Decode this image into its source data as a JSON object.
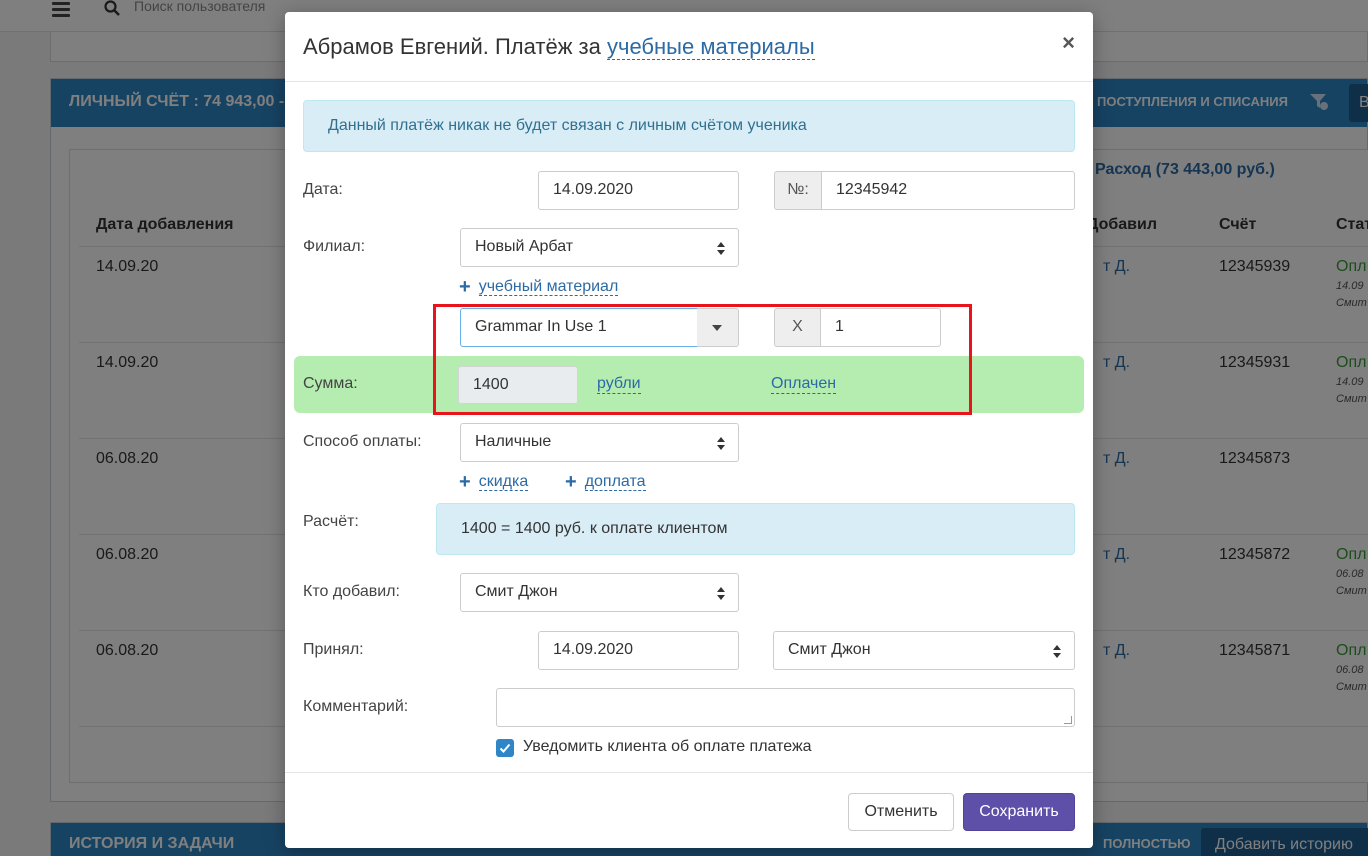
{
  "background": {
    "search_placeholder": "Поиск пользователя",
    "account_title": "ЛИЧНЫЙ СЧЁТ :  74 943,00 -",
    "account_right": "ПОСТУПЛЕНИЯ И СПИСАНИЯ",
    "header_btn": "В",
    "expense_link": "Расход (73 443,00 руб.)",
    "columns": [
      "Дата добавления",
      "Добавил",
      "Счёт",
      "Стат"
    ],
    "rows": [
      {
        "date": "14.09.20",
        "added_by": "т Д.",
        "account": "12345939",
        "status": "Опл",
        "status_date": "14.09",
        "status_user": "Смит"
      },
      {
        "date": "14.09.20",
        "added_by": "т Д.",
        "account": "12345931",
        "status": "Опл",
        "status_date": "14.09",
        "status_user": "Смит"
      },
      {
        "date": "06.08.20",
        "added_by": "т Д.",
        "account": "12345873",
        "status": "",
        "status_date": "",
        "status_user": ""
      },
      {
        "date": "06.08.20",
        "added_by": "т Д.",
        "account": "12345872",
        "status": "Опл",
        "status_date": "06.08",
        "status_user": "Смит"
      },
      {
        "date": "06.08.20",
        "added_by": "т Д.",
        "account": "12345871",
        "status": "Опл",
        "status_date": "06.08",
        "status_user": "Смит"
      }
    ],
    "history_title": "ИСТОРИЯ И ЗАДАЧИ",
    "history_right": "ПОЛНОСТЬЮ",
    "history_btn": "Добавить историю"
  },
  "modal": {
    "title_prefix": "Абрамов Евгений. Платёж за",
    "title_link": "учебные материалы",
    "close": "×",
    "info_alert": "Данный платёж никак не будет связан с личным счётом ученика",
    "date_label": "Дата:",
    "date_value": "14.09.2020",
    "number_addon": "№:",
    "number_value": "12345942",
    "branch_label": "Филиал:",
    "branch_value": "Новый Арбат",
    "add_material": "учебный материал",
    "material_value": "Grammar In Use 1",
    "qty_addon": "X",
    "qty_value": "1",
    "sum_label": "Сумма:",
    "sum_value": "1400",
    "currency_link": "рубли",
    "paid_link": "Оплачен",
    "payment_method_label": "Способ оплаты:",
    "payment_method_value": "Наличные",
    "discount_link": "скидка",
    "surcharge_link": "доплата",
    "calc_label": "Расчёт:",
    "calc_value": "1400 = 1400 руб. к оплате клиентом",
    "added_by_label": "Кто добавил:",
    "added_by_value": "Смит Джон",
    "accepted_label": "Принял:",
    "accepted_date": "14.09.2020",
    "accepted_user": "Смит Джон",
    "comment_label": "Комментарий:",
    "notify_label": "Уведомить клиента об оплате платежа",
    "notify_checked": true,
    "cancel_btn": "Отменить",
    "save_btn": "Сохранить"
  },
  "colors": {
    "primary": "#2f86c6",
    "save": "#5e4fa8",
    "sum_row": "#b5edb0",
    "info": "#d9edf7",
    "highlight": "#e8141b"
  }
}
